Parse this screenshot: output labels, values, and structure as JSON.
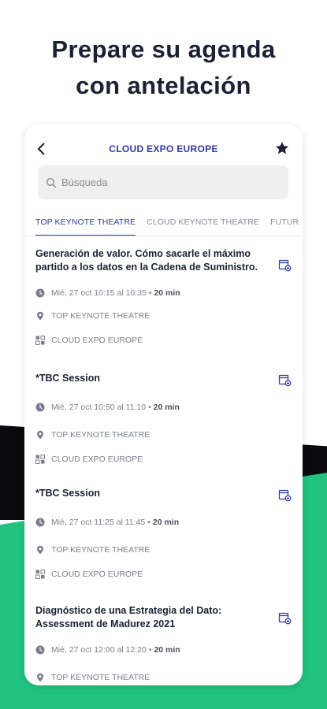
{
  "hero": {
    "line1": "Prepare su agenda",
    "line2": "con antelación"
  },
  "header": {
    "title": "CLOUD EXPO EUROPE"
  },
  "search": {
    "placeholder": "Búsqueda"
  },
  "tabs": [
    {
      "label": "TOP KEYNOTE THEATRE",
      "active": true
    },
    {
      "label": "CLOUD KEYNOTE THEATRE",
      "active": false
    },
    {
      "label": "FUTUR",
      "active": false
    }
  ],
  "sessions": [
    {
      "title": "Generación de valor. Cómo sacarle el máximo partido a los datos en la Cadena de Suministro.",
      "time": "Mié, 27 oct 10:15 al 10:35 •",
      "duration": "20 min",
      "location": "TOP KEYNOTE THEATRE",
      "event": "CLOUD EXPO EUROPE"
    },
    {
      "title": "*TBC Session",
      "time": "Mié, 27 oct 10:50 al 11:10 •",
      "duration": "20 min",
      "location": "TOP KEYNOTE THEATRE",
      "event": "CLOUD EXPO EUROPE"
    },
    {
      "title": "*TBC Session",
      "time": "Mié, 27 oct 11:25 al 11:45 •",
      "duration": "20 min",
      "location": "TOP KEYNOTE THEATRE",
      "event": "CLOUD EXPO EUROPE"
    },
    {
      "title": "Diagnóstico de una Estrategia del Dato: Assessment de Madurez 2021",
      "time": "Mié, 27 oct 12:00 al 12:20 •",
      "duration": "20 min",
      "location": "TOP KEYNOTE THEATRE"
    }
  ],
  "colors": {
    "accent": "#2f3aa8",
    "green": "#22c37f",
    "dark": "#0b0b0f"
  },
  "icons": [
    "back-arrow-icon",
    "star-icon",
    "search-icon",
    "calendar-add-icon",
    "clock-icon",
    "location-pin-icon",
    "event-badge-icon"
  ]
}
